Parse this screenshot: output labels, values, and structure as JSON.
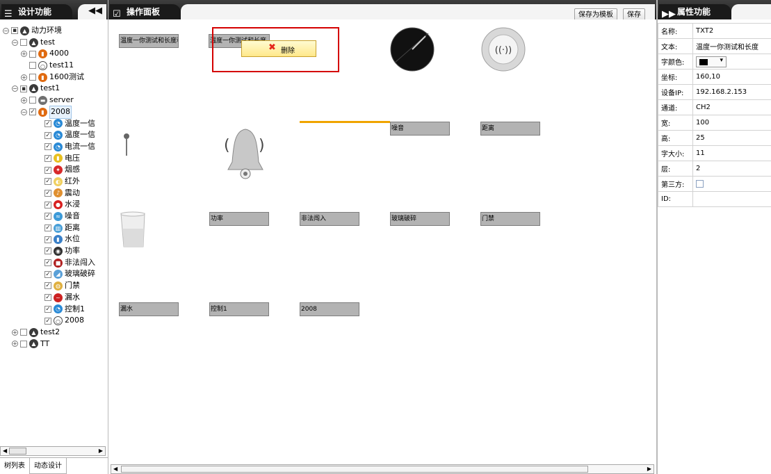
{
  "left": {
    "title": "设计功能",
    "tree": [
      {
        "label": "动力环境",
        "toggle": "⊟",
        "cb": "minus",
        "icon": "grp",
        "indent": 0
      },
      {
        "label": "test",
        "toggle": "⊟",
        "cb": "empty",
        "icon": "grp",
        "indent": 1
      },
      {
        "label": "4000",
        "toggle": "⊕",
        "cb": "empty",
        "icon": "dev",
        "indent": 2
      },
      {
        "label": "test11",
        "toggle": "",
        "cb": "empty",
        "icon": "dev2",
        "indent": 2
      },
      {
        "label": "1600测试",
        "toggle": "⊕",
        "cb": "empty",
        "icon": "dev",
        "indent": 2
      },
      {
        "label": "test1",
        "toggle": "⊟",
        "cb": "minus",
        "icon": "grp",
        "indent": 1
      },
      {
        "label": "server",
        "toggle": "⊕",
        "cb": "empty",
        "icon": "srv",
        "indent": 2
      },
      {
        "label": "2008",
        "toggle": "⊟",
        "cb": "check",
        "icon": "dev",
        "indent": 2
      },
      {
        "label": "温度一信",
        "toggle": "",
        "cb": "check",
        "icon": "blue",
        "indent": 3
      },
      {
        "label": "温度一信",
        "toggle": "",
        "cb": "check",
        "icon": "blue",
        "indent": 3
      },
      {
        "label": "电流一信",
        "toggle": "",
        "cb": "check",
        "icon": "blue",
        "indent": 3
      },
      {
        "label": "电压",
        "toggle": "",
        "cb": "check",
        "icon": "volt",
        "indent": 3
      },
      {
        "label": "烟感",
        "toggle": "",
        "cb": "check",
        "icon": "fire",
        "indent": 3
      },
      {
        "label": "红外",
        "toggle": "",
        "cb": "check",
        "icon": "ir",
        "indent": 3
      },
      {
        "label": "震动",
        "toggle": "",
        "cb": "check",
        "icon": "shake",
        "indent": 3
      },
      {
        "label": "水浸",
        "toggle": "",
        "cb": "check",
        "icon": "water",
        "indent": 3
      },
      {
        "label": "噪音",
        "toggle": "",
        "cb": "check",
        "icon": "noise",
        "indent": 3
      },
      {
        "label": "距离",
        "toggle": "",
        "cb": "check",
        "icon": "dist",
        "indent": 3
      },
      {
        "label": "水位",
        "toggle": "",
        "cb": "check",
        "icon": "level",
        "indent": 3
      },
      {
        "label": "功率",
        "toggle": "",
        "cb": "check",
        "icon": "power",
        "indent": 3
      },
      {
        "label": "非法闯入",
        "toggle": "",
        "cb": "check",
        "icon": "intr",
        "indent": 3
      },
      {
        "label": "玻璃破碎",
        "toggle": "",
        "cb": "check",
        "icon": "glass",
        "indent": 3
      },
      {
        "label": "门禁",
        "toggle": "",
        "cb": "check",
        "icon": "lock",
        "indent": 3
      },
      {
        "label": "漏水",
        "toggle": "",
        "cb": "check",
        "icon": "leak",
        "indent": 3
      },
      {
        "label": "控制1",
        "toggle": "",
        "cb": "check",
        "icon": "blue",
        "indent": 3
      },
      {
        "label": "2008",
        "toggle": "",
        "cb": "check",
        "icon": "dev2",
        "indent": 3
      },
      {
        "label": "test2",
        "toggle": "⊕",
        "cb": "empty",
        "icon": "grp",
        "indent": 1
      },
      {
        "label": "TT",
        "toggle": "⊕",
        "cb": "empty",
        "icon": "grp",
        "indent": 1
      }
    ],
    "tabs": [
      "树列表",
      "动态设计"
    ]
  },
  "center": {
    "title": "操作面板",
    "save_template": "保存为模板",
    "save": "保存",
    "context_menu": {
      "delete": "删除"
    },
    "widgets": [
      {
        "label": "温度一你测试和长度和"
      },
      {
        "label": "温度一你测试和长度"
      },
      {
        "label": "噪音"
      },
      {
        "label": "距离"
      },
      {
        "label": "功率"
      },
      {
        "label": "非法闯入"
      },
      {
        "label": "玻璃破碎"
      },
      {
        "label": "门禁"
      },
      {
        "label": "漏水"
      },
      {
        "label": "控制1"
      },
      {
        "label": "2008"
      }
    ],
    "icons": [
      "clock-gauge-icon",
      "smoke-detector-icon",
      "pin-icon",
      "alarm-bell-icon",
      "beaker-icon"
    ]
  },
  "right": {
    "title": "属性功能",
    "props": [
      {
        "k": "名称:",
        "v": "TXT2"
      },
      {
        "k": "文本:",
        "v": "温度一你测试和长度"
      },
      {
        "k": "字颜色:",
        "v": ""
      },
      {
        "k": "坐标:",
        "v": "160,10"
      },
      {
        "k": "设备IP:",
        "v": "192.168.2.153"
      },
      {
        "k": "通道:",
        "v": "CH2"
      },
      {
        "k": "宽:",
        "v": "100"
      },
      {
        "k": "高:",
        "v": "25"
      },
      {
        "k": "字大小:",
        "v": "11"
      },
      {
        "k": "层:",
        "v": "2"
      },
      {
        "k": "第三方:",
        "v": ""
      },
      {
        "k": "ID:",
        "v": ""
      }
    ]
  },
  "colors": {
    "selection_border": "#d40000",
    "line": "#f0a400",
    "menu_bg": "#fff3a8",
    "font_color": "#000000"
  }
}
